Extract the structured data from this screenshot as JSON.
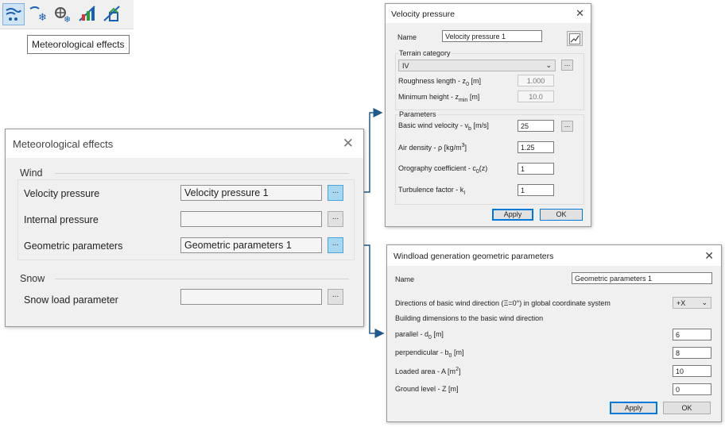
{
  "toolbar": {
    "buttons": [
      {
        "icon": "wind-pressure-icon",
        "active": true
      },
      {
        "icon": "snow-wind-icon",
        "active": false
      },
      {
        "icon": "fan-snow-icon",
        "active": false
      },
      {
        "icon": "wind-load-icon",
        "active": false
      },
      {
        "icon": "wind-building-icon",
        "active": false
      }
    ],
    "tooltip": "Meteorological effects"
  },
  "main_dialog": {
    "title": "Meteorological effects",
    "wind_section": "Wind",
    "velocity_label": "Velocity pressure",
    "velocity_value": "Velocity pressure 1",
    "internal_label": "Internal pressure",
    "internal_value": "",
    "geometric_label": "Geometric parameters",
    "geometric_value": "Geometric parameters 1",
    "snow_section": "Snow",
    "snow_label": "Snow load parameter",
    "snow_value": "",
    "ellipsis": "..."
  },
  "velocity_dialog": {
    "title": "Velocity pressure",
    "name_label": "Name",
    "name_value": "Velocity pressure 1",
    "terrain_group": "Terrain category",
    "terrain_value": "IV",
    "roughness_label": "Roughness length - z",
    "roughness_sub": "0",
    "roughness_unit": " [m]",
    "roughness_value": "1.000",
    "minheight_label": "Minimum height - z",
    "minheight_sub": "min",
    "minheight_unit": " [m]",
    "minheight_value": "10.0",
    "params_group": "Parameters",
    "basic_label": "Basic wind velocity - v",
    "basic_sub": "b",
    "basic_unit": " [m/s]",
    "basic_value": "25",
    "air_label": "Air density - ρ [kg/m",
    "air_sup": "3",
    "air_end": "]",
    "air_value": "1.25",
    "oro_label": "Orography coefficient - c",
    "oro_sub": "0",
    "oro_end": "(z)",
    "oro_value": "1",
    "turb_label": "Turbulence factor - k",
    "turb_sub": "I",
    "turb_value": "1",
    "apply": "Apply",
    "ok": "OK",
    "ellipsis": "..."
  },
  "windload_dialog": {
    "title": "Windload generation geometric parameters",
    "name_label": "Name",
    "name_value": "Geometric parameters 1",
    "direction_label": "Directions of basic wind direction (Ξ=0°) in global coordinate system",
    "direction_value": "+X",
    "dims_label": "Building dimensions to the basic wind direction",
    "parallel_label": "parallel - d",
    "parallel_sub": "0",
    "parallel_unit": " [m]",
    "parallel_value": "6",
    "perp_label": "perpendicular - b",
    "perp_sub": "0",
    "perp_unit": " [m]",
    "perp_value": "8",
    "area_label": "Loaded area - A [m",
    "area_sup": "2",
    "area_end": "]",
    "area_value": "10",
    "ground_label": "Ground level - Z [m]",
    "ground_value": "0",
    "apply": "Apply",
    "ok": "OK"
  },
  "colors": {
    "accent": "#0078d7",
    "connector": "#1f5a8a",
    "highlight": "#a8d8f0"
  }
}
